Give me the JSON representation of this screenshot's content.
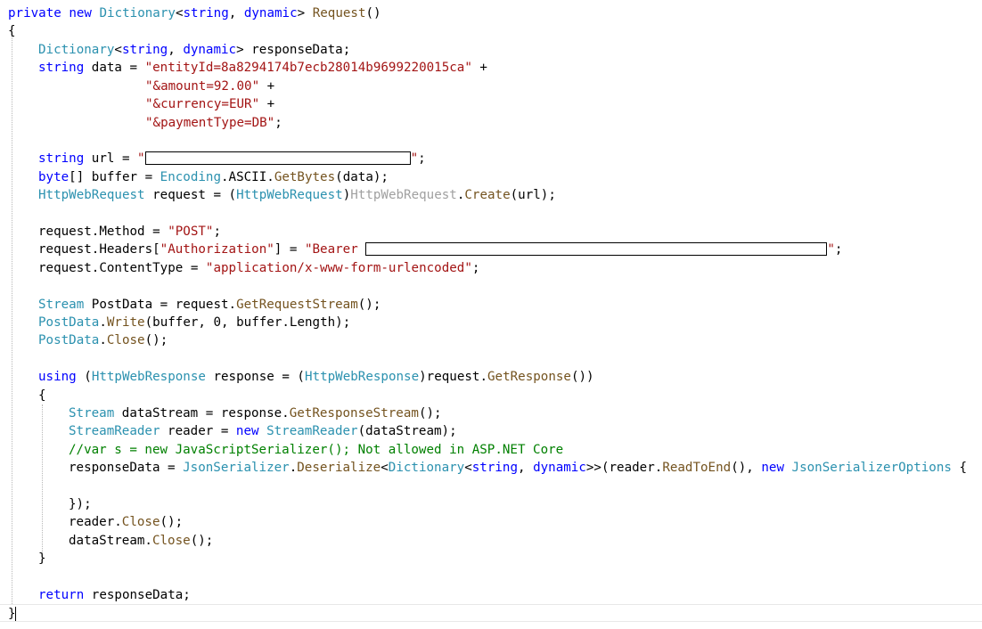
{
  "editor": {
    "lines": {
      "l01": {
        "kw1": "private",
        "kw2": "new",
        "ty1": "Dictionary",
        "p1": "<",
        "kw3": "string",
        "p2": ", ",
        "kw4": "dynamic",
        "p3": "> ",
        "mt1": "Request",
        "p4": "()"
      },
      "l02": {
        "p1": "{"
      },
      "l03": {
        "ty1": "Dictionary",
        "p1": "<",
        "kw1": "string",
        "p2": ", ",
        "kw2": "dynamic",
        "p3": "> responseData;"
      },
      "l04": {
        "kw1": "string",
        "p1": " data = ",
        "st1": "\"entityId=8a8294174b7ecb28014b9699220015ca\"",
        "p2": " +"
      },
      "l05": {
        "st1": "\"&amount=92.00\"",
        "p1": " +"
      },
      "l06": {
        "st1": "\"&currency=EUR\"",
        "p1": " +"
      },
      "l07": {
        "st1": "\"&paymentType=DB\"",
        "p1": ";"
      },
      "l08": {
        "kw1": "string",
        "p1": " url = ",
        "st1": "\"",
        "st2": "\"",
        "p2": ";"
      },
      "l09": {
        "kw1": "byte",
        "p1": "[] buffer = ",
        "ty1": "Encoding",
        "p2": ".ASCII.",
        "mt1": "GetBytes",
        "p3": "(data);"
      },
      "l10": {
        "ty1": "HttpWebRequest",
        "p1": " request = (",
        "ty2": "HttpWebRequest",
        "p2": ")",
        "gr1": "HttpWebRequest",
        "p3": ".",
        "mt1": "Create",
        "p4": "(url);"
      },
      "l11": {
        "p1": "request.Method = ",
        "st1": "\"POST\"",
        "p2": ";"
      },
      "l12": {
        "p1": "request.Headers[",
        "st1": "\"Authorization\"",
        "p2": "] = ",
        "st2": "\"Bearer ",
        "st3": "\"",
        "p3": ";"
      },
      "l13": {
        "p1": "request.ContentType = ",
        "st1": "\"application/x-www-form-urlencoded\"",
        "p2": ";"
      },
      "l14": {
        "ty1": "Stream",
        "p1": " PostData = request.",
        "mt1": "GetRequestStream",
        "p2": "();"
      },
      "l15": {
        "ty1": "PostData",
        "p1": ".",
        "mt1": "Write",
        "p2": "(buffer, 0, buffer.Length);"
      },
      "l16": {
        "ty1": "PostData",
        "p1": ".",
        "mt1": "Close",
        "p2": "();"
      },
      "l17": {
        "kw1": "using",
        "p1": " (",
        "ty1": "HttpWebResponse",
        "p2": " response = (",
        "ty2": "HttpWebResponse",
        "p3": ")request.",
        "mt1": "GetResponse",
        "p4": "())"
      },
      "l18": {
        "p1": "{"
      },
      "l19": {
        "ty1": "Stream",
        "p1": " dataStream = response.",
        "mt1": "GetResponseStream",
        "p2": "();"
      },
      "l20": {
        "ty1": "StreamReader",
        "p1": " reader = ",
        "kw1": "new",
        "p2": " ",
        "ty2": "StreamReader",
        "p3": "(dataStream);"
      },
      "l21": {
        "cm1": "//var s = new JavaScriptSerializer(); Not allowed in ASP.NET Core"
      },
      "l22": {
        "p1": "responseData = ",
        "ty1": "JsonSerializer",
        "p2": ".",
        "mt1": "Deserialize",
        "p3": "<",
        "ty2": "Dictionary",
        "p4": "<",
        "kw1": "string",
        "p5": ", ",
        "kw2": "dynamic",
        "p6": ">>(reader.",
        "mt2": "ReadToEnd",
        "p7": "(), ",
        "kw3": "new",
        "p8": " ",
        "ty3": "JsonSerializerOptions",
        "p9": " {"
      },
      "l23": {
        "p1": "});"
      },
      "l24": {
        "p1": "reader.",
        "mt1": "Close",
        "p2": "();"
      },
      "l25": {
        "p1": "dataStream.",
        "mt1": "Close",
        "p2": "();"
      },
      "l26": {
        "p1": "}"
      },
      "l27": {
        "kw1": "return",
        "p1": " responseData;"
      },
      "l28": {
        "p1": "}"
      }
    },
    "colors": {
      "keyword": "#0000ff",
      "type": "#2b91af",
      "string": "#a31515",
      "comment": "#008000",
      "method": "#74531f",
      "unused": "#a0a0a0"
    }
  }
}
